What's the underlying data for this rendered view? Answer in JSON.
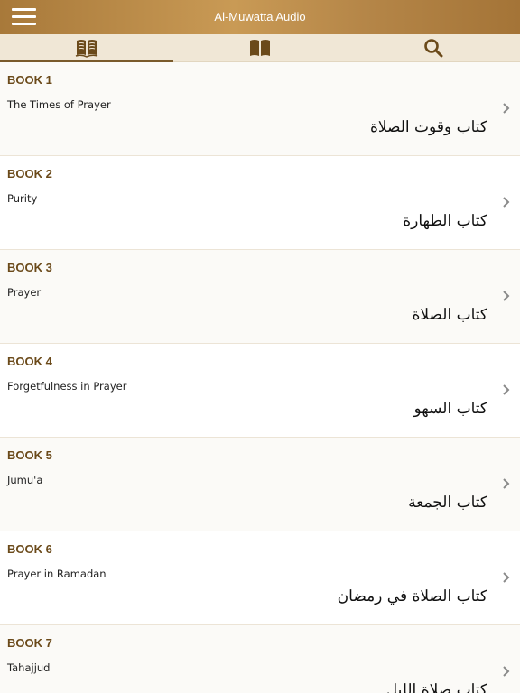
{
  "header": {
    "title": "Al-Muwatta Audio",
    "menu_icon": "hamburger-menu-icon"
  },
  "tabs": [
    {
      "icon": "open-book-icon",
      "active": true
    },
    {
      "icon": "closed-book-icon",
      "active": false
    },
    {
      "icon": "search-icon",
      "active": false
    }
  ],
  "books": [
    {
      "number": "BOOK 1",
      "english": "The Times of Prayer",
      "arabic": "كتاب وقوت الصلاة"
    },
    {
      "number": "BOOK 2",
      "english": "Purity",
      "arabic": "كتاب الطهارة"
    },
    {
      "number": "BOOK 3",
      "english": "Prayer",
      "arabic": "كتاب الصلاة"
    },
    {
      "number": "BOOK 4",
      "english": "Forgetfulness in Prayer",
      "arabic": "كتاب السهو"
    },
    {
      "number": "BOOK 5",
      "english": "Jumu'a",
      "arabic": "كتاب الجمعة"
    },
    {
      "number": "BOOK 6",
      "english": "Prayer in Ramadan",
      "arabic": "كتاب الصلاة في رمضان"
    },
    {
      "number": "BOOK 7",
      "english": "Tahajjud",
      "arabic": "كتاب صلاة الليل"
    }
  ],
  "colors": {
    "header_gradient_start": "#a8793a",
    "header_gradient_mid": "#c99a55",
    "accent_brown": "#6b4a1a",
    "tabbar_bg": "#f0e7d6"
  }
}
